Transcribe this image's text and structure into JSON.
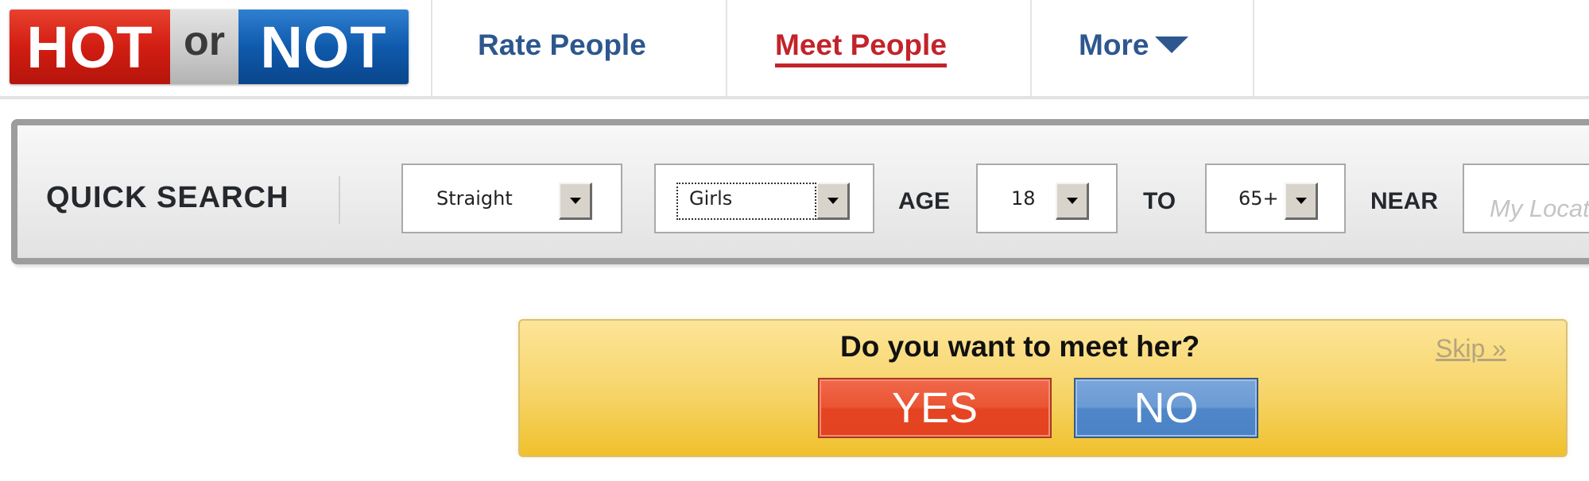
{
  "logo": {
    "hot": "HOT",
    "or": "or",
    "not": "NOT"
  },
  "nav": {
    "items": [
      {
        "label": "Rate People",
        "active": false
      },
      {
        "label": "Meet People",
        "active": true
      },
      {
        "label": "More",
        "icon": "caret-down-icon"
      }
    ]
  },
  "quick_search": {
    "title": "QUICK SEARCH",
    "orientation": {
      "value": "Straight"
    },
    "gender": {
      "value": "Girls"
    },
    "age_label": "AGE",
    "age_from": {
      "value": "18"
    },
    "to_label": "TO",
    "age_to": {
      "value": "65+"
    },
    "near_label": "NEAR",
    "location": {
      "value": "",
      "placeholder": "My Location"
    }
  },
  "meet_prompt": {
    "question": "Do you want to meet her?",
    "skip_label": "Skip »",
    "yes_label": "YES",
    "no_label": "NO"
  },
  "colors": {
    "hot_red": "#d21d12",
    "not_blue": "#0f5aad",
    "nav_blue": "#2d578e",
    "nav_active_red": "#c3232b",
    "yes_red": "#e54422",
    "no_blue": "#4f86c8",
    "prompt_yellow": "#f6d468"
  }
}
